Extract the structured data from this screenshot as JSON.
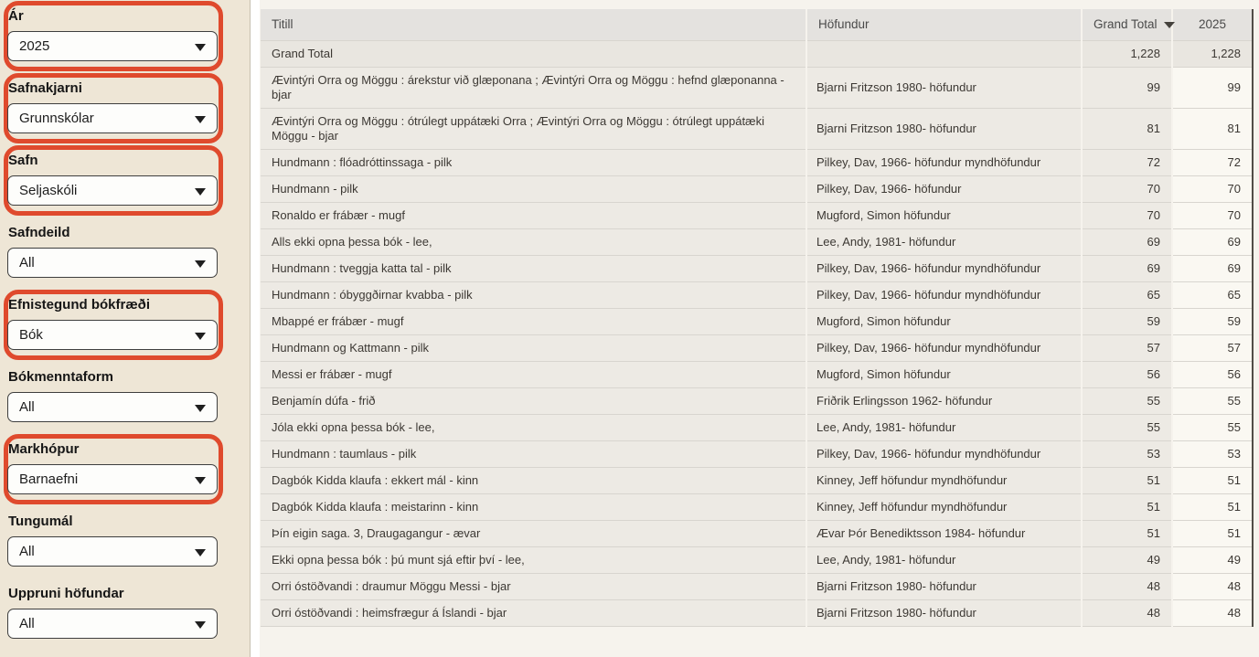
{
  "colors": {
    "highlight_ring": "#DF4A2D",
    "sidebar_background": "#EEE6D6",
    "main_background": "#F6F3ED",
    "header_background": "#E4E2DF",
    "row_background": "#EDEAE4",
    "year_column_background": "#FAF8F2"
  },
  "icons": {
    "dropdown_caret": "triangle-down",
    "sort_descending": "triangle-down"
  },
  "sidebar": {
    "filters": [
      {
        "label": "Ár",
        "value": "2025",
        "highlighted": true
      },
      {
        "label": "Safnakjarni",
        "value": "Grunnskólar",
        "highlighted": true
      },
      {
        "label": "Safn",
        "value": "Seljaskóli",
        "highlighted": true
      },
      {
        "label": "Safndeild",
        "value": "All",
        "highlighted": false
      },
      {
        "label": "Efnistegund bókfræði",
        "value": "Bók",
        "highlighted": true
      },
      {
        "label": "Bókmenntaform",
        "value": "All",
        "highlighted": false
      },
      {
        "label": "Markhópur",
        "value": "Barnaefni",
        "highlighted": true
      },
      {
        "label": "Tungumál",
        "value": "All",
        "highlighted": false
      },
      {
        "label": "Uppruni höfundar",
        "value": "All",
        "highlighted": false
      }
    ]
  },
  "table": {
    "columns": [
      "Titill",
      "Höfundur",
      "Grand Total",
      "2025"
    ],
    "sort": {
      "column": "Grand Total",
      "direction": "descending"
    },
    "grand_total_row": {
      "title": "Grand Total",
      "author": "",
      "grand_total": "1,228",
      "y2025": "1,228"
    },
    "rows": [
      {
        "title": "Ævintýri Orra og Möggu : árekstur við glæponana ; Ævintýri Orra og Möggu : hefnd glæponanna - bjar",
        "author": "Bjarni Fritzson 1980- höfundur",
        "grand_total": "99",
        "y2025": "99"
      },
      {
        "title": "Ævintýri Orra og Möggu : ótrúlegt uppátæki Orra ; Ævintýri Orra og Möggu : ótrúlegt uppátæki Möggu - bjar",
        "author": "Bjarni Fritzson 1980- höfundur",
        "grand_total": "81",
        "y2025": "81"
      },
      {
        "title": "Hundmann : flóadróttinssaga - pilk",
        "author": "Pilkey, Dav, 1966- höfundur myndhöfundur",
        "grand_total": "72",
        "y2025": "72"
      },
      {
        "title": "Hundmann - pilk",
        "author": "Pilkey, Dav, 1966- höfundur",
        "grand_total": "70",
        "y2025": "70"
      },
      {
        "title": "Ronaldo er frábær - mugf",
        "author": "Mugford, Simon höfundur",
        "grand_total": "70",
        "y2025": "70"
      },
      {
        "title": "Alls ekki opna þessa bók - lee,",
        "author": "Lee, Andy, 1981- höfundur",
        "grand_total": "69",
        "y2025": "69"
      },
      {
        "title": "Hundmann : tveggja katta tal - pilk",
        "author": "Pilkey, Dav, 1966- höfundur myndhöfundur",
        "grand_total": "69",
        "y2025": "69"
      },
      {
        "title": "Hundmann : óbyggðirnar kvabba - pilk",
        "author": "Pilkey, Dav, 1966- höfundur myndhöfundur",
        "grand_total": "65",
        "y2025": "65"
      },
      {
        "title": "Mbappé er frábær - mugf",
        "author": "Mugford, Simon höfundur",
        "grand_total": "59",
        "y2025": "59"
      },
      {
        "title": "Hundmann og Kattmann - pilk",
        "author": "Pilkey, Dav, 1966- höfundur myndhöfundur",
        "grand_total": "57",
        "y2025": "57"
      },
      {
        "title": "Messi er frábær - mugf",
        "author": "Mugford, Simon höfundur",
        "grand_total": "56",
        "y2025": "56"
      },
      {
        "title": "Benjamín dúfa - frið",
        "author": "Friðrik Erlingsson 1962- höfundur",
        "grand_total": "55",
        "y2025": "55"
      },
      {
        "title": "Jóla ekki opna þessa bók - lee,",
        "author": "Lee, Andy, 1981- höfundur",
        "grand_total": "55",
        "y2025": "55"
      },
      {
        "title": "Hundmann : taumlaus - pilk",
        "author": "Pilkey, Dav, 1966- höfundur myndhöfundur",
        "grand_total": "53",
        "y2025": "53"
      },
      {
        "title": "Dagbók Kidda klaufa : ekkert mál - kinn",
        "author": "Kinney, Jeff höfundur myndhöfundur",
        "grand_total": "51",
        "y2025": "51"
      },
      {
        "title": "Dagbók Kidda klaufa : meistarinn - kinn",
        "author": "Kinney, Jeff höfundur myndhöfundur",
        "grand_total": "51",
        "y2025": "51"
      },
      {
        "title": "Þín eigin saga. 3, Draugagangur - ævar",
        "author": "Ævar Þór Benediktsson 1984- höfundur",
        "grand_total": "51",
        "y2025": "51"
      },
      {
        "title": "Ekki opna þessa bók : þú munt sjá eftir því - lee,",
        "author": "Lee, Andy, 1981- höfundur",
        "grand_total": "49",
        "y2025": "49"
      },
      {
        "title": "Orri óstöðvandi : draumur Möggu Messi - bjar",
        "author": "Bjarni Fritzson 1980- höfundur",
        "grand_total": "48",
        "y2025": "48"
      },
      {
        "title": "Orri óstöðvandi : heimsfrægur á Íslandi - bjar",
        "author": "Bjarni Fritzson 1980- höfundur",
        "grand_total": "48",
        "y2025": "48"
      }
    ]
  }
}
